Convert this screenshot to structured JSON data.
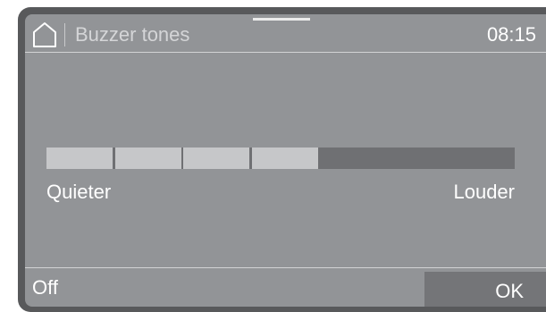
{
  "header": {
    "home_icon": "home-icon",
    "title": "Buzzer tones",
    "clock": "08:15"
  },
  "volume": {
    "level": 4,
    "max_level": 7,
    "segment_count": 7,
    "min_label": "Quieter",
    "max_label": "Louder"
  },
  "footer": {
    "off_label": "Off",
    "ok_label": "OK"
  },
  "colors": {
    "screen_background": "#929497",
    "bezel": "#58595b",
    "filled_segment": "#c6c7c9",
    "empty_track": "#6f7073",
    "ok_button_background": "#747578"
  }
}
